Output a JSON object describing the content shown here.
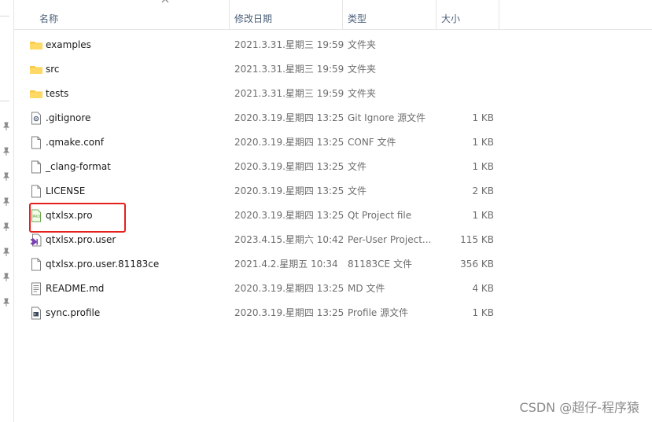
{
  "columns": {
    "name": "名称",
    "date": "修改日期",
    "type": "类型",
    "size": "大小"
  },
  "files": [
    {
      "name": "examples",
      "date": "2021.3.31.星期三 19:59",
      "type": "文件夹",
      "size": "",
      "icon": "folder-icon"
    },
    {
      "name": "src",
      "date": "2021.3.31.星期三 19:59",
      "type": "文件夹",
      "size": "",
      "icon": "folder-icon"
    },
    {
      "name": "tests",
      "date": "2021.3.31.星期三 19:59",
      "type": "文件夹",
      "size": "",
      "icon": "folder-icon"
    },
    {
      "name": ".gitignore",
      "date": "2020.3.19.星期四 13:25",
      "type": "Git Ignore 源文件",
      "size": "1 KB",
      "icon": "gear-file-icon"
    },
    {
      "name": ".qmake.conf",
      "date": "2020.3.19.星期四 13:25",
      "type": "CONF 文件",
      "size": "1 KB",
      "icon": "file-icon"
    },
    {
      "name": "_clang-format",
      "date": "2020.3.19.星期四 13:25",
      "type": "文件",
      "size": "1 KB",
      "icon": "file-icon"
    },
    {
      "name": "LICENSE",
      "date": "2020.3.19.星期四 13:25",
      "type": "文件",
      "size": "2 KB",
      "icon": "file-icon"
    },
    {
      "name": "qtxlsx.pro",
      "date": "2020.3.19.星期四 13:25",
      "type": "Qt Project file",
      "size": "1 KB",
      "icon": "qt-pro-file-icon"
    },
    {
      "name": "qtxlsx.pro.user",
      "date": "2023.4.15.星期六 10:42",
      "type": "Per-User Project...",
      "size": "115 KB",
      "icon": "vs-user-file-icon"
    },
    {
      "name": "qtxlsx.pro.user.81183ce",
      "date": "2021.4.2.星期五 10:34",
      "type": "81183CE 文件",
      "size": "356 KB",
      "icon": "file-icon"
    },
    {
      "name": "README.md",
      "date": "2020.3.19.星期四 13:25",
      "type": "MD 文件",
      "size": "4 KB",
      "icon": "text-file-icon"
    },
    {
      "name": "sync.profile",
      "date": "2020.3.19.星期四 13:25",
      "type": "Profile 源文件",
      "size": "1 KB",
      "icon": "script-file-icon"
    }
  ],
  "highlighted_file": "qtxlsx.pro",
  "highlight_color": "#e5211d",
  "watermark": "CSDN @超仔-程序猿"
}
